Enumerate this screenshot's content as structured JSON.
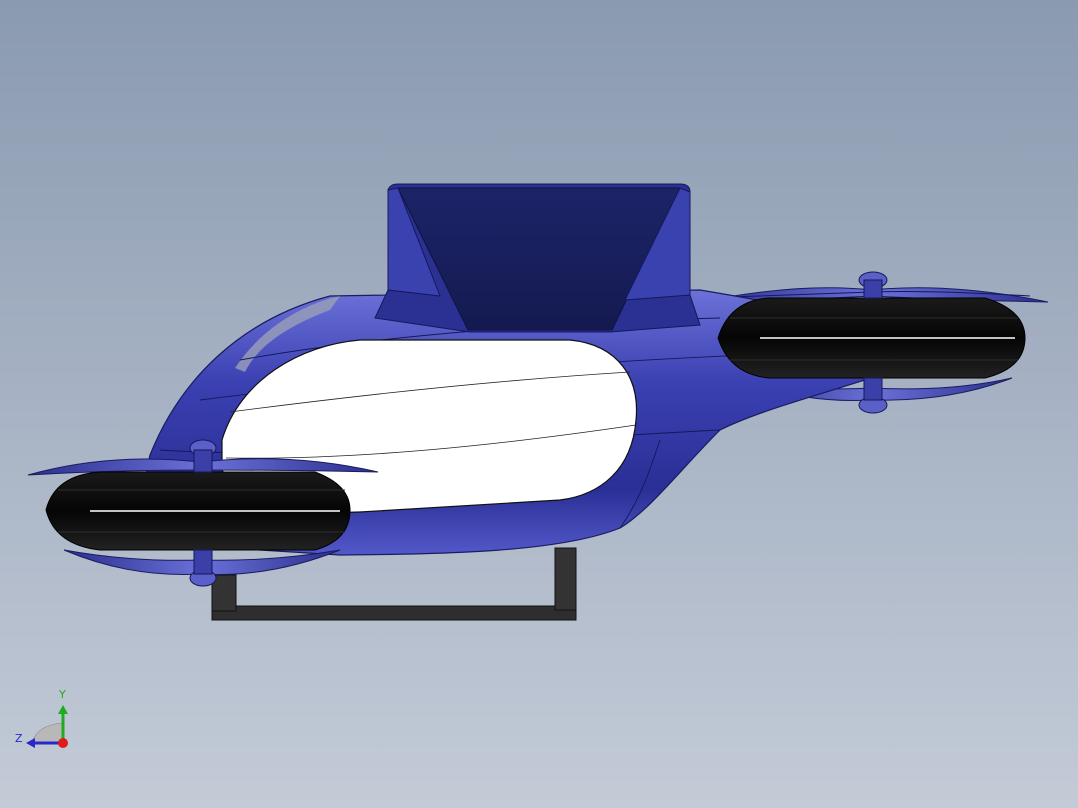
{
  "viewport": {
    "background_top": "#8a9ab0",
    "background_bottom": "#c3cbd7"
  },
  "model": {
    "body_color": "#3a3fb0",
    "body_highlight": "#8a90e8",
    "canopy_color": "#ffffff",
    "intake_color": "#1a2160",
    "ducted_fan_color": "#0d0d0d",
    "skid_color": "#2a2a2a"
  },
  "triad": {
    "y_label": "Y",
    "z_label": "Z",
    "y_color": "#1faa1f",
    "z_color": "#2828c8",
    "x_point_color": "#e01b1b",
    "y_arrow_icon": "arrow-up-icon",
    "z_arrow_icon": "arrow-left-icon"
  }
}
